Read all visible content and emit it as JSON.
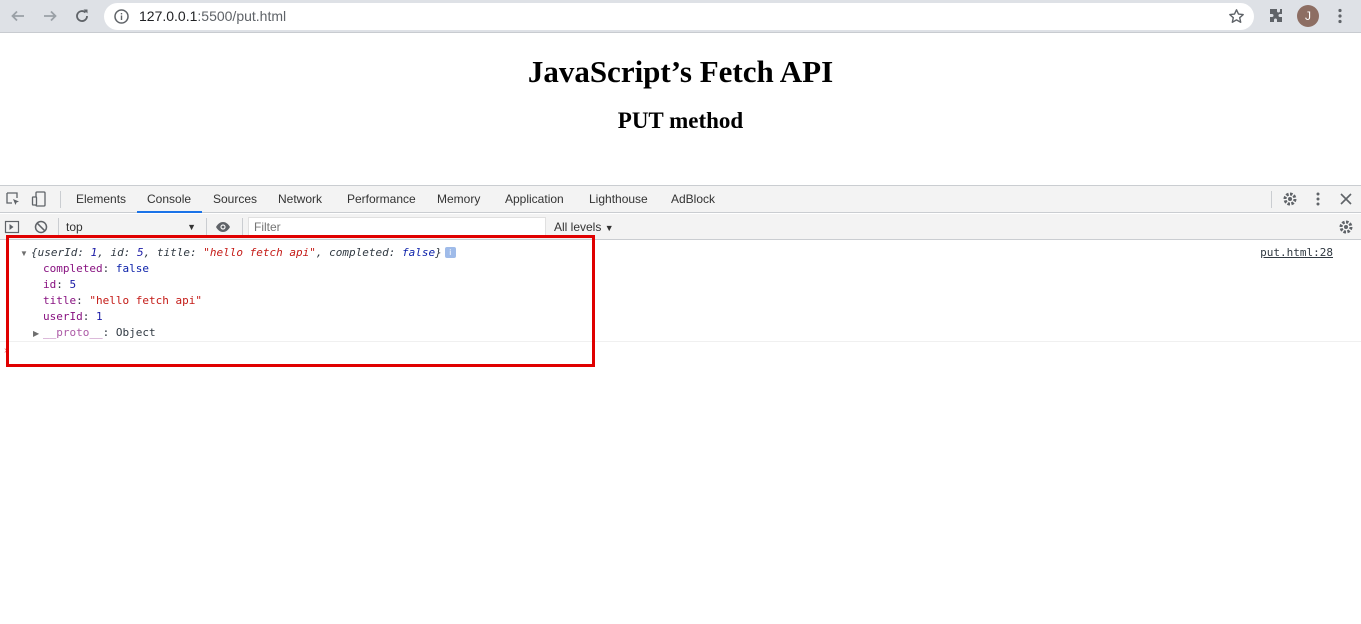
{
  "browser": {
    "url_host": "127.0.0.1",
    "url_rest": ":5500/put.html",
    "avatar_letter": "J",
    "icons": [
      "back-icon",
      "forward-icon",
      "reload-icon",
      "info-icon",
      "star-icon",
      "puzzle-icon",
      "kebab-menu-icon"
    ]
  },
  "page": {
    "title": "JavaScript’s Fetch API",
    "subtitle": "PUT method"
  },
  "devtools": {
    "tabs": [
      {
        "label": "Elements"
      },
      {
        "label": "Console"
      },
      {
        "label": "Sources"
      },
      {
        "label": "Network"
      },
      {
        "label": "Performance"
      },
      {
        "label": "Memory"
      },
      {
        "label": "Application"
      },
      {
        "label": "Lighthouse"
      },
      {
        "label": "AdBlock"
      }
    ],
    "active_tab": "Console",
    "context": "top",
    "filter_placeholder": "Filter",
    "levels": "All levels"
  },
  "console": {
    "source_link": "put.html:28",
    "summary": {
      "open": "{",
      "k1": "userId",
      "v1": "1",
      "k2": "id",
      "v2": "5",
      "k3": "title",
      "v3": "\"hello fetch api\"",
      "k4": "completed",
      "v4": "false",
      "close": "}",
      "badge": "i"
    },
    "props": [
      {
        "key": "completed",
        "value": "false"
      },
      {
        "key": "id",
        "value": "5"
      },
      {
        "key": "title",
        "value": "\"hello fetch api\""
      },
      {
        "key": "userId",
        "value": "1"
      }
    ],
    "proto": {
      "key": "__proto__",
      "value": "Object"
    }
  },
  "colors": {
    "highlight": "#e00000",
    "active_tab_underline": "#1a73e8",
    "string": "#c41a16",
    "number": "#1a1aa6",
    "key": "#881280"
  }
}
